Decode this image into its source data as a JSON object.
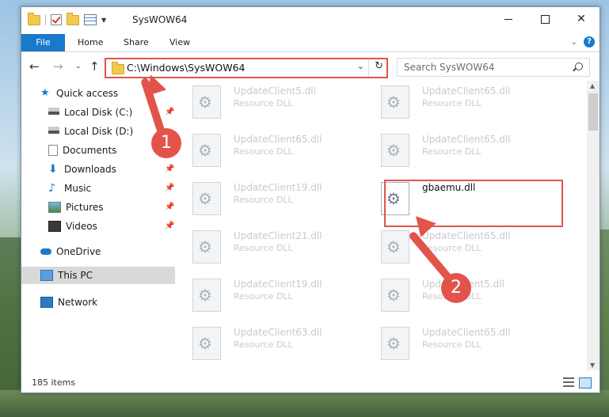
{
  "window": {
    "title": "SysWOW64"
  },
  "ribbon": {
    "tabs": [
      "File",
      "Home",
      "Share",
      "View"
    ],
    "help": "?"
  },
  "navbar": {
    "address": "C:\\Windows\\SysWOW64",
    "search_placeholder": "Search SysWOW64"
  },
  "sidebar": {
    "items": [
      {
        "label": "Quick access",
        "icon": "star-icon"
      },
      {
        "label": "Local Disk (C:)",
        "icon": "drive-icon",
        "pinned": true
      },
      {
        "label": "Local Disk (D:)",
        "icon": "drive-icon",
        "pinned": true
      },
      {
        "label": "Documents",
        "icon": "documents-icon",
        "pinned": true
      },
      {
        "label": "Downloads",
        "icon": "download-icon",
        "pinned": true
      },
      {
        "label": "Music",
        "icon": "music-icon",
        "pinned": true
      },
      {
        "label": "Pictures",
        "icon": "pictures-icon",
        "pinned": true
      },
      {
        "label": "Videos",
        "icon": "videos-icon",
        "pinned": true
      },
      {
        "label": "OneDrive",
        "icon": "cloud-icon"
      },
      {
        "label": "This PC",
        "icon": "computer-icon",
        "selected": true
      },
      {
        "label": "Network",
        "icon": "network-icon"
      }
    ]
  },
  "files": [
    {
      "name": "UpdateClient5.dll",
      "type": "Resource DLL"
    },
    {
      "name": "UpdateClient65.dll",
      "type": "Resource DLL"
    },
    {
      "name": "UpdateClient65.dll",
      "type": "Resource DLL"
    },
    {
      "name": "UpdateClient65.dll",
      "type": "Resource DLL"
    },
    {
      "name": "UpdateClient19.dll",
      "type": "Resource DLL"
    },
    {
      "name": "gbaemu.dll",
      "type": "",
      "highlighted": true
    },
    {
      "name": "UpdateClient21.dll",
      "type": "Resource DLL"
    },
    {
      "name": "UpdateClient65.dll",
      "type": "Resource DLL"
    },
    {
      "name": "UpdateClient19.dll",
      "type": "Resource DLL"
    },
    {
      "name": "UpdateClient5.dll",
      "type": "Resource DLL"
    },
    {
      "name": "UpdateClient63.dll",
      "type": "Resource DLL"
    },
    {
      "name": "UpdateClient65.dll",
      "type": "Resource DLL"
    }
  ],
  "status": {
    "items_count": "185 items"
  },
  "annotations": {
    "step1": "1",
    "step2": "2",
    "accent_color": "#e2544b"
  }
}
